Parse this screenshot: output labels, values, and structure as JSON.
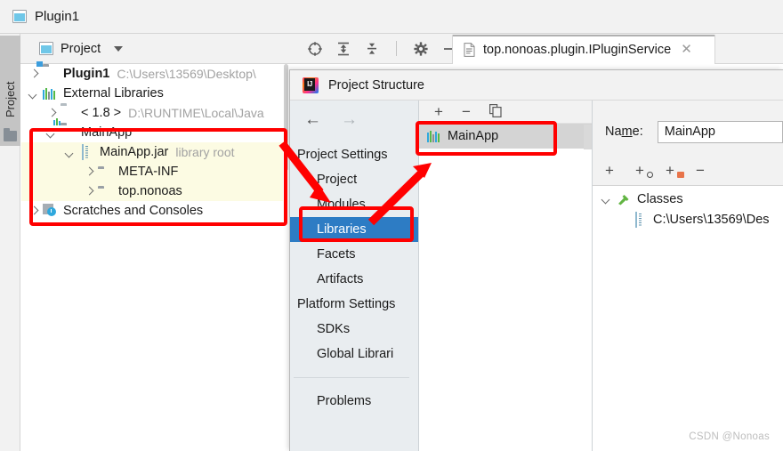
{
  "window": {
    "title": "Plugin1",
    "icon": "project-window-icon"
  },
  "project_panel": {
    "label": "Project",
    "tool_tab_label": "Project",
    "dropdown_icon": "chevron-down-icon",
    "toolbar": [
      {
        "name": "select-opened-file-icon",
        "glyph": "target-icon"
      },
      {
        "name": "expand-all-icon",
        "glyph": "expand-all-icon"
      },
      {
        "name": "collapse-all-icon",
        "glyph": "collapse-all-icon"
      },
      {
        "name": "settings-icon",
        "glyph": "gear-icon"
      },
      {
        "name": "hide-icon",
        "glyph": "minus-icon"
      }
    ],
    "tree": [
      {
        "label": "Plugin1",
        "sub": "C:\\Users\\13569\\Desktop\\",
        "icon": "module-folder-icon",
        "arrow": "right",
        "indent": 0,
        "bold": true,
        "highlight": false
      },
      {
        "label": "External Libraries",
        "sub": "",
        "icon": "library-bars-icon",
        "arrow": "down",
        "indent": 0,
        "bold": false,
        "highlight": false
      },
      {
        "label": "< 1.8 >",
        "sub": "D:\\RUNTIME\\Local\\Java",
        "icon": "sdk-folder-icon",
        "arrow": "right",
        "indent": 1,
        "bold": false,
        "highlight": false
      },
      {
        "label": "MainApp",
        "sub": "",
        "icon": "library-folder-icon",
        "arrow": "down",
        "indent": 1,
        "bold": false,
        "highlight": false
      },
      {
        "label": "MainApp.jar",
        "sub": "library root",
        "icon": "jar-icon",
        "arrow": "down",
        "indent": 2,
        "bold": false,
        "highlight": true
      },
      {
        "label": "META-INF",
        "sub": "",
        "icon": "folder-icon",
        "arrow": "right",
        "indent": 3,
        "bold": false,
        "highlight": true
      },
      {
        "label": "top.nonoas",
        "sub": "",
        "icon": "folder-icon",
        "arrow": "right",
        "indent": 3,
        "bold": false,
        "highlight": true
      },
      {
        "label": "Scratches and Consoles",
        "sub": "",
        "icon": "scratches-icon",
        "arrow": "right",
        "indent": 0,
        "bold": false,
        "highlight": false
      }
    ]
  },
  "editor_tab": {
    "title": "top.nonoas.plugin.IPluginService",
    "file_icon": "java-file-icon",
    "close_icon": "close-icon"
  },
  "dialog": {
    "title": "Project Structure",
    "logo": "intellij-idea-logo",
    "nav": {
      "back": "←",
      "forward": "→"
    },
    "sidebar": [
      {
        "label": "Project Settings",
        "type": "group",
        "selected": false
      },
      {
        "label": "Project",
        "type": "child",
        "selected": false
      },
      {
        "label": "Modules",
        "type": "child",
        "selected": false
      },
      {
        "label": "Libraries",
        "type": "child",
        "selected": true
      },
      {
        "label": "Facets",
        "type": "child",
        "selected": false
      },
      {
        "label": "Artifacts",
        "type": "child",
        "selected": false
      },
      {
        "label": "Platform Settings",
        "type": "group",
        "selected": false
      },
      {
        "label": "SDKs",
        "type": "child",
        "selected": false
      },
      {
        "label": "Global Librari",
        "type": "child",
        "selected": false
      },
      {
        "label": "Problems",
        "type": "child-after-sep",
        "selected": false
      }
    ],
    "middle": {
      "toolbar": [
        {
          "name": "add-library-button",
          "glyph": "+"
        },
        {
          "name": "remove-library-button",
          "glyph": "−"
        },
        {
          "name": "copy-library-button",
          "glyph": "copy-icon"
        }
      ],
      "items": [
        {
          "label": "MainApp",
          "icon": "library-bars-icon",
          "selected": true
        }
      ]
    },
    "right": {
      "name_label_pre": "Na",
      "name_label_mnemonic": "m",
      "name_label_post": "e:",
      "name_value": "MainApp",
      "classes_toolbar": [
        {
          "name": "add-classes-button",
          "glyph": "+"
        },
        {
          "name": "add-jar-directory-button",
          "glyph": "+"
        },
        {
          "name": "add-directory-button",
          "glyph": "+"
        },
        {
          "name": "remove-classes-button",
          "glyph": "−"
        }
      ],
      "tree": [
        {
          "label": "Classes",
          "icon": "classes-root-icon",
          "arrow": "down",
          "level": 1
        },
        {
          "label": "C:\\Users\\13569\\Des",
          "icon": "jar-icon",
          "arrow": "none",
          "level": 2
        }
      ]
    }
  },
  "annotations": {
    "color": "#ff0000",
    "boxes": [
      {
        "name": "annotation-box-project-tree"
      },
      {
        "name": "annotation-box-libraries"
      },
      {
        "name": "annotation-box-mainapp-library"
      }
    ],
    "arrows": [
      {
        "name": "annotation-arrow-to-libraries"
      },
      {
        "name": "annotation-arrow-to-mainapp"
      }
    ]
  },
  "watermark": {
    "text": "CSDN @Nonoas"
  }
}
